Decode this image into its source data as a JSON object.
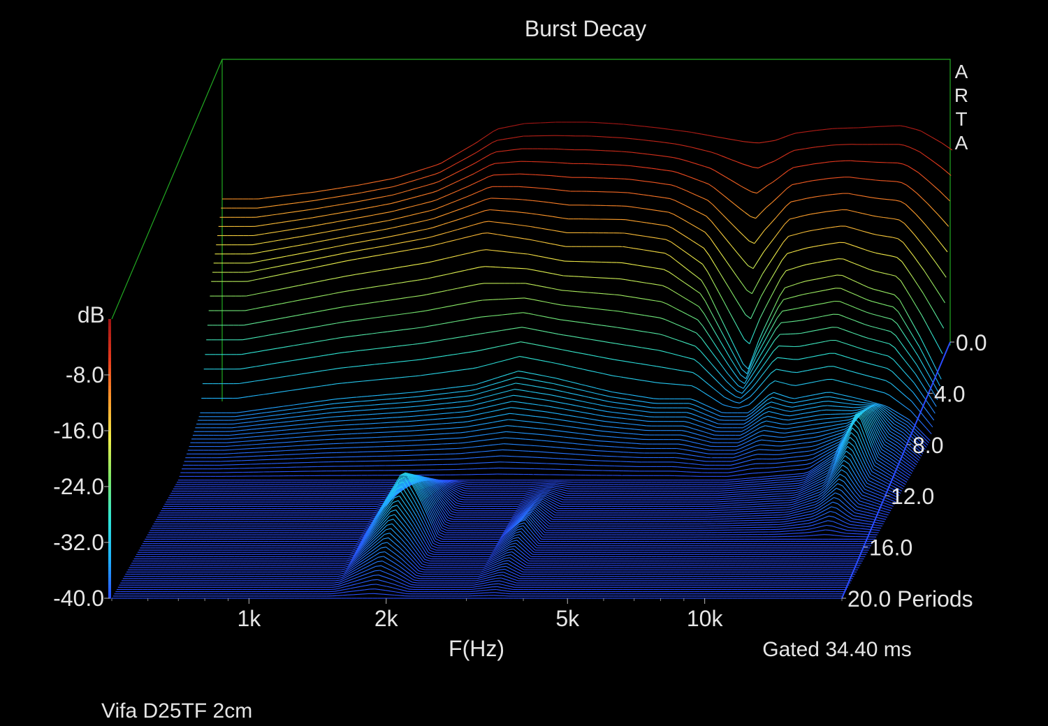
{
  "chart_data": {
    "type": "waterfall",
    "title": "Burst Decay",
    "watermark": "ARTA",
    "xlabel": "F(Hz)",
    "x_scale": "log",
    "x_ticks": [
      {
        "value": 1000,
        "label": "1k"
      },
      {
        "value": 2000,
        "label": "2k"
      },
      {
        "value": 5000,
        "label": "5k"
      },
      {
        "value": 10000,
        "label": "10k"
      }
    ],
    "xlim": [
      500,
      20000
    ],
    "zlabel": "dB",
    "zlim": [
      -40,
      0
    ],
    "z_ticks": [
      {
        "value": -8,
        "label": "-8.0"
      },
      {
        "value": -16,
        "label": "-16.0"
      },
      {
        "value": -24,
        "label": "-24.0"
      },
      {
        "value": -32,
        "label": "-32.0"
      },
      {
        "value": -40,
        "label": "-40.0"
      }
    ],
    "ylabel": "Periods",
    "ylim": [
      0,
      20
    ],
    "y_ticks": [
      {
        "value": 0,
        "label": "0.0"
      },
      {
        "value": 4,
        "label": "4.0"
      },
      {
        "value": 8,
        "label": "8.0"
      },
      {
        "value": 12,
        "label": "12.0"
      },
      {
        "value": 16,
        "label": "16.0"
      },
      {
        "value": 20,
        "label": "20.0 Periods"
      }
    ],
    "gate_note": "Gated 34.40 ms",
    "device_note": "Vifa D25TF 2cm",
    "colormap": [
      "#2a4cff",
      "#1fb3ff",
      "#2ee6d6",
      "#7be86a",
      "#f0f04a",
      "#ff9a2a",
      "#e83a1e",
      "#a01414"
    ],
    "frame_color": "#22aa22",
    "series": [
      {
        "periods": 0,
        "freqs": [
          600,
          800,
          1000,
          1200,
          1500,
          1800,
          2000,
          2300,
          2700,
          3200,
          3800,
          4500,
          5300,
          6200,
          7000,
          7500,
          8200,
          9000,
          10000,
          11000,
          12500,
          14000,
          15500,
          17000,
          19000,
          20000
        ],
        "levels": [
          -11,
          -10,
          -9,
          -8,
          -6,
          -3,
          -1,
          -0.2,
          0,
          0,
          -0.3,
          -0.8,
          -1.4,
          -2.2,
          -2.8,
          -3.0,
          -2.6,
          -1.6,
          -1.2,
          -0.9,
          -0.8,
          -0.6,
          -0.5,
          -1.2,
          -3,
          -4
        ]
      },
      {
        "periods": 2,
        "freqs": [
          600,
          1000,
          1500,
          2000,
          2500,
          3000,
          4000,
          5000,
          6000,
          7000,
          7500,
          8000,
          9000,
          10000,
          12000,
          14000,
          16000,
          18000,
          20000
        ],
        "levels": [
          -20,
          -17,
          -15,
          -13,
          -14,
          -15,
          -15,
          -16,
          -20,
          -29,
          -33,
          -28,
          -21,
          -20,
          -19,
          -21,
          -22,
          -28,
          -34
        ]
      },
      {
        "periods": 4,
        "freqs": [
          600,
          1000,
          1500,
          2000,
          2500,
          3000,
          4000,
          5000,
          6000,
          7000,
          8000,
          9000,
          10000,
          12000,
          14000,
          16000,
          18000,
          20000
        ],
        "levels": [
          -36,
          -34,
          -33,
          -32,
          -30,
          -31,
          -33,
          -34,
          -34,
          -36,
          -36,
          -33,
          -34,
          -33,
          -34,
          -35,
          -37,
          -40
        ]
      },
      {
        "periods": 8,
        "freqs": [
          600,
          1000,
          2000,
          4000,
          8000,
          12000,
          14000,
          15500,
          17000,
          20000
        ],
        "levels": [
          -40,
          -40,
          -40,
          -40,
          -40,
          -39,
          -36,
          -30,
          -37,
          -40
        ]
      },
      {
        "periods": 14,
        "freqs": [
          600,
          1500,
          1700,
          1850,
          2000,
          2200,
          3000,
          3400,
          3700,
          4000,
          8000,
          20000
        ],
        "levels": [
          -40,
          -40,
          -34,
          -30,
          -34,
          -40,
          -40,
          -37,
          -40,
          -40,
          -40,
          -40
        ]
      },
      {
        "periods": 20,
        "freqs": [
          600,
          20000
        ],
        "levels": [
          -40,
          -40
        ]
      }
    ]
  }
}
